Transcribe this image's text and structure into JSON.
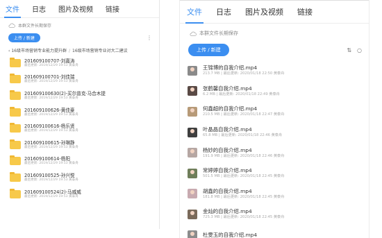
{
  "left": {
    "tabs": [
      "文件",
      "日志",
      "图片及视频",
      "链接"
    ],
    "notice": "本群文件长期保存",
    "upload_label": "上传 / 新建",
    "menu_icon": "⋮",
    "breadcrumb": [
      "16级市场营销专业能力提升群",
      "16级市场营销专业对大二建议"
    ],
    "folders": [
      {
        "name": "201609100707-刘嘉涛",
        "meta": "最后更新: 2019/12/29 19:53  黄泰舟"
      },
      {
        "name": "201609100701-刘佳瑞",
        "meta": "最后更新: 2019/12/29 19:53  黄泰舟"
      },
      {
        "name": "201609100630(2)-买尔普克·马合木提",
        "meta": "最后更新: 2019/12/29 19:53  黄泰舟"
      },
      {
        "name": "201609100626-黄佳豪",
        "meta": "最后更新: 2019/12/29 19:53  黄泰舟"
      },
      {
        "name": "201609100616-杨乐贤",
        "meta": "最后更新: 2019/12/29 19:53  黄泰舟"
      },
      {
        "name": "201609100615-孙琳静",
        "meta": "最后更新: 2019/12/29 19:53  黄泰舟"
      },
      {
        "name": "201609100614-杨阳",
        "meta": "最后更新: 2019/12/29 19:53  黄泰舟"
      },
      {
        "name": "201609100525-孙兴悦",
        "meta": "最后更新: 2019/12/29 19:53  黄泰舟"
      },
      {
        "name": "201609100524(2)-马威威",
        "meta": "最后更新: 2019/12/29 19:53  黄泰舟"
      }
    ]
  },
  "right": {
    "tabs": [
      "文件",
      "日志",
      "图片及视频",
      "链接"
    ],
    "notice": "本群文件长期保存",
    "upload_label": "上传 / 新建",
    "sort_icon": "⇅",
    "search_icon": "○",
    "files": [
      {
        "name": "王锦博的自我介绍.mp4",
        "meta": "213.7 MB  |  最后更新: 2020/01/18 22:50  黄泰舟",
        "color": "#8a8a8a"
      },
      {
        "name": "张鹤馨自我介绍.mp4",
        "meta": "6.2 MB  |  最后更新: 2020/01/18 22:49  黄泰舟",
        "color": "#5a4a45"
      },
      {
        "name": "何鑫超的自我介绍.mp4",
        "meta": "210.5 MB  |  最后更新: 2020/01/18 22:47  黄泰舟",
        "color": "#b79a78"
      },
      {
        "name": "叶晶晶自我介绍.mp4",
        "meta": "65.8 MB  |  最后更新: 2020/01/18 22:46  黄泰舟",
        "color": "#3f3f3f"
      },
      {
        "name": "杨妙的自我介绍.mp4",
        "meta": "191.9 MB  |  最后更新: 2020/01/18 22:46  黄泰舟",
        "color": "#b6a7a3"
      },
      {
        "name": "常婷婷自我介绍.mp4",
        "meta": "501.5 MB  |  最后更新: 2020/01/18 22:45  黄泰舟",
        "color": "#6f7e5a"
      },
      {
        "name": "胡鑫的自我介绍.mp4",
        "meta": "181.8 MB  |  最后更新: 2020/01/18 22:45  黄泰舟",
        "color": "#c8aab0"
      },
      {
        "name": "金灿的自我介绍.mp4",
        "meta": "725.3 MB  |  最后更新: 2020/01/18 22:45  黄泰舟",
        "color": "#7a6a5a"
      },
      {
        "name": "杜雯玉的自我介绍.mp4",
        "meta": "",
        "color": "#8c8c8c"
      }
    ]
  },
  "colors": {
    "accent": "#3b8ef0",
    "folder": "#f7c94a"
  },
  "icons": {
    "cloud": "cloud-icon",
    "folder": "folder-icon",
    "sort": "sort-icon",
    "search": "search-icon",
    "more": "more-icon"
  }
}
